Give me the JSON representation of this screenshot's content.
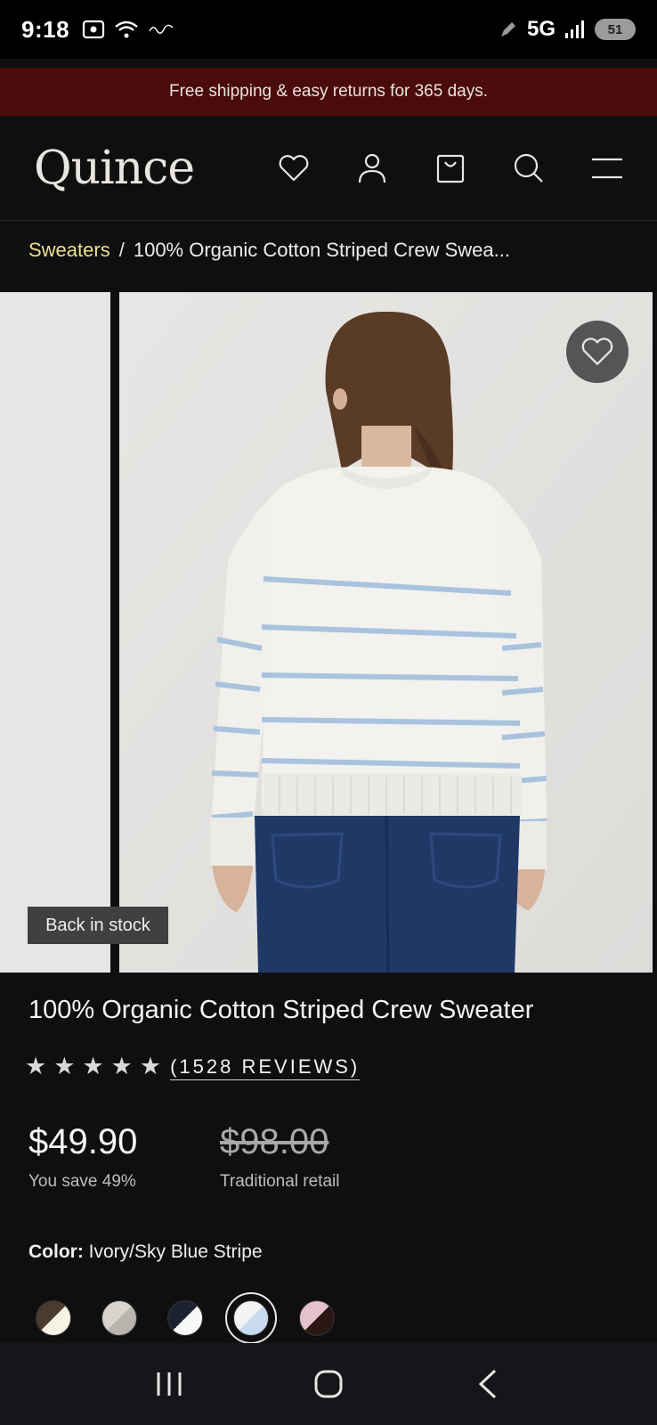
{
  "status_bar": {
    "time": "9:18",
    "network": "5G",
    "battery": "51"
  },
  "promo": {
    "text": "Free shipping & easy returns for 365 days."
  },
  "header": {
    "logo": "Quince",
    "icons": [
      "heart-icon",
      "account-icon",
      "bag-icon",
      "search-icon",
      "menu-icon"
    ]
  },
  "breadcrumb": {
    "parent": "Sweaters",
    "separator": "/",
    "current": "100% Organic Cotton Striped Crew Swea..."
  },
  "gallery": {
    "badge": "Back in stock"
  },
  "product": {
    "title": "100% Organic Cotton Striped Crew Sweater",
    "rating_stars": 5,
    "reviews": "(1528 REVIEWS)",
    "price": "$49.90",
    "savings": "You save 49%",
    "retail_price": "$98.00",
    "retail_label": "Traditional retail",
    "color_label": "Color:",
    "color_value": "Ivory/Sky Blue Stripe"
  },
  "swatches": [
    {
      "left": "#4a3a30",
      "right": "#f7f2e6",
      "selected": false
    },
    {
      "left": "#d8d4ce",
      "right": "#b8b4ae",
      "selected": false
    },
    {
      "left": "#1d2233",
      "right": "#f7f7f7",
      "selected": false
    },
    {
      "left": "#f4f4f2",
      "right": "#c9dbef",
      "selected": true
    },
    {
      "left": "#e3c2cd",
      "right": "#2a1714",
      "selected": false
    }
  ],
  "colors": {
    "promo_bg": "#4a0b0b",
    "link": "#ede08f",
    "background": "#0f0f10"
  }
}
